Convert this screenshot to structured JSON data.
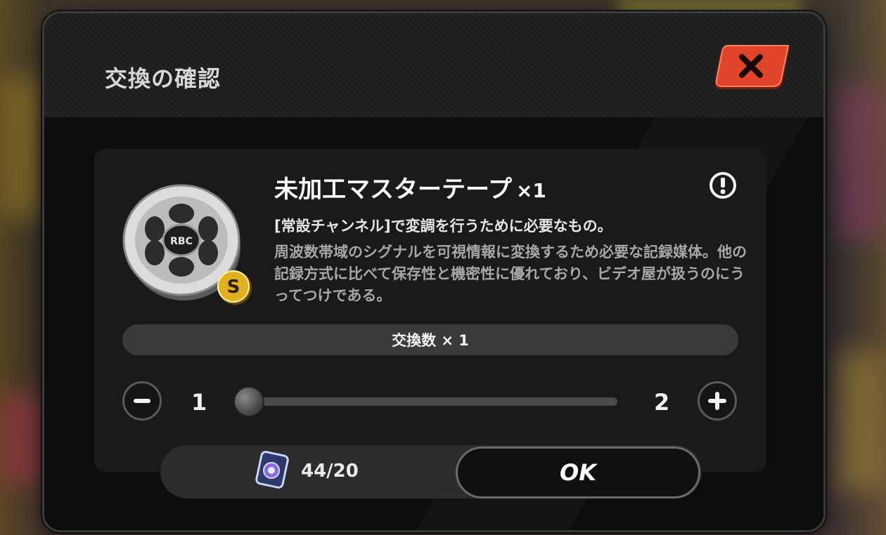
{
  "dialog": {
    "title": "交換の確認",
    "close_icon": "close-x-icon"
  },
  "item": {
    "icon": "film-reel-icon",
    "rank_badge": "S",
    "name": "未加工マスターテープ",
    "quantity": "×1",
    "info_icon": "info-exclamation-icon",
    "subtitle": "[常設チャンネル]で変調を行うために必要なもの。",
    "description": "周波数帯域のシグナルを可視情報に変換するため必要な記録媒体。他の記録方式に比べて保存性と機密性に優れており、ビデオ屋が扱うのにうってつけである。"
  },
  "exchange": {
    "count_label": "交換数 × 1",
    "min": "1",
    "max": "2",
    "value": 1,
    "minus_icon": "minus-icon",
    "plus_icon": "plus-icon"
  },
  "footer": {
    "cost_icon": "ticket-card-icon",
    "cost": "44/20",
    "ok_label": "OK"
  },
  "colors": {
    "close_button": "#e0452a",
    "rank_badge": "#e0b020"
  }
}
